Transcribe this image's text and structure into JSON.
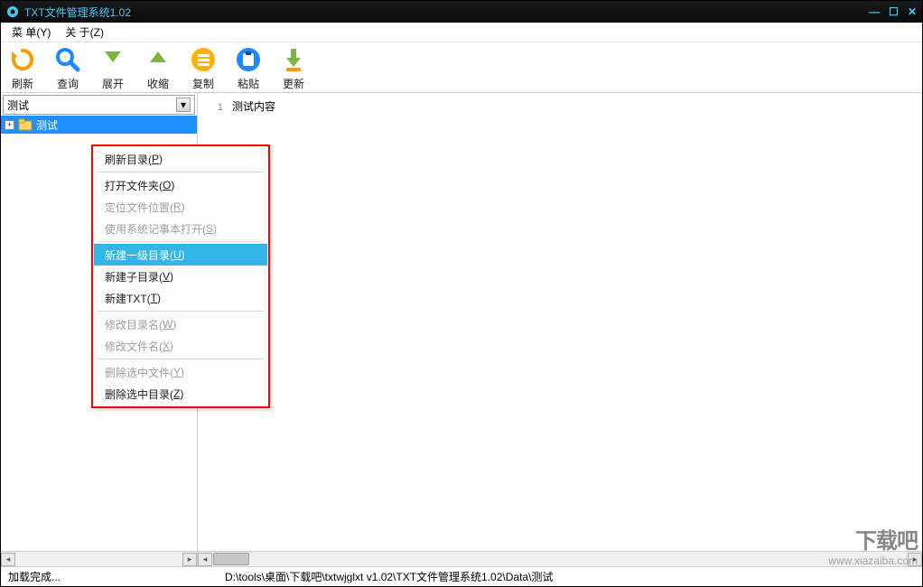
{
  "title": "TXT文件管理系统1.02",
  "menubar": {
    "menu": "菜 单(Y)",
    "about": "关 于(Z)"
  },
  "toolbar": {
    "refresh": "刷新",
    "query": "查询",
    "expand": "展开",
    "collapse": "收缩",
    "copy": "复制",
    "paste": "粘贴",
    "update": "更新"
  },
  "combo": {
    "value": "测试"
  },
  "tree": {
    "root": "测试"
  },
  "editor": {
    "line1_no": "1",
    "line1_text": "测试内容"
  },
  "context_menu": {
    "refresh_dir": {
      "t": "刷新目录(",
      "k": "P",
      "e": ")"
    },
    "open_folder": {
      "t": "打开文件夹(",
      "k": "O",
      "e": ")"
    },
    "locate_file": {
      "t": "定位文件位置(",
      "k": "R",
      "e": ")"
    },
    "open_notepad": {
      "t": "使用系统记事本打开(",
      "k": "S",
      "e": ")"
    },
    "new_top_dir": {
      "t": "新建一级目录(",
      "k": "U",
      "e": ")"
    },
    "new_sub_dir": {
      "t": "新建子目录(",
      "k": "V",
      "e": ")"
    },
    "new_txt": {
      "t": "新建TXT(",
      "k": "T",
      "e": ")"
    },
    "rename_dir": {
      "t": "修改目录名(",
      "k": "W",
      "e": ")"
    },
    "rename_file": {
      "t": "修改文件名(",
      "k": "X",
      "e": ")"
    },
    "delete_file": {
      "t": "删除选中文件(",
      "k": "Y",
      "e": ")"
    },
    "delete_dir": {
      "t": "删除选中目录(",
      "k": "Z",
      "e": ")"
    }
  },
  "status": {
    "left": "加载完成...",
    "path": "D:\\tools\\桌面\\下载吧\\txtwjglxt v1.02\\TXT文件管理系统1.02\\Data\\测试"
  },
  "watermark": {
    "big": "下载吧",
    "url": "www.xiazaiba.com"
  }
}
